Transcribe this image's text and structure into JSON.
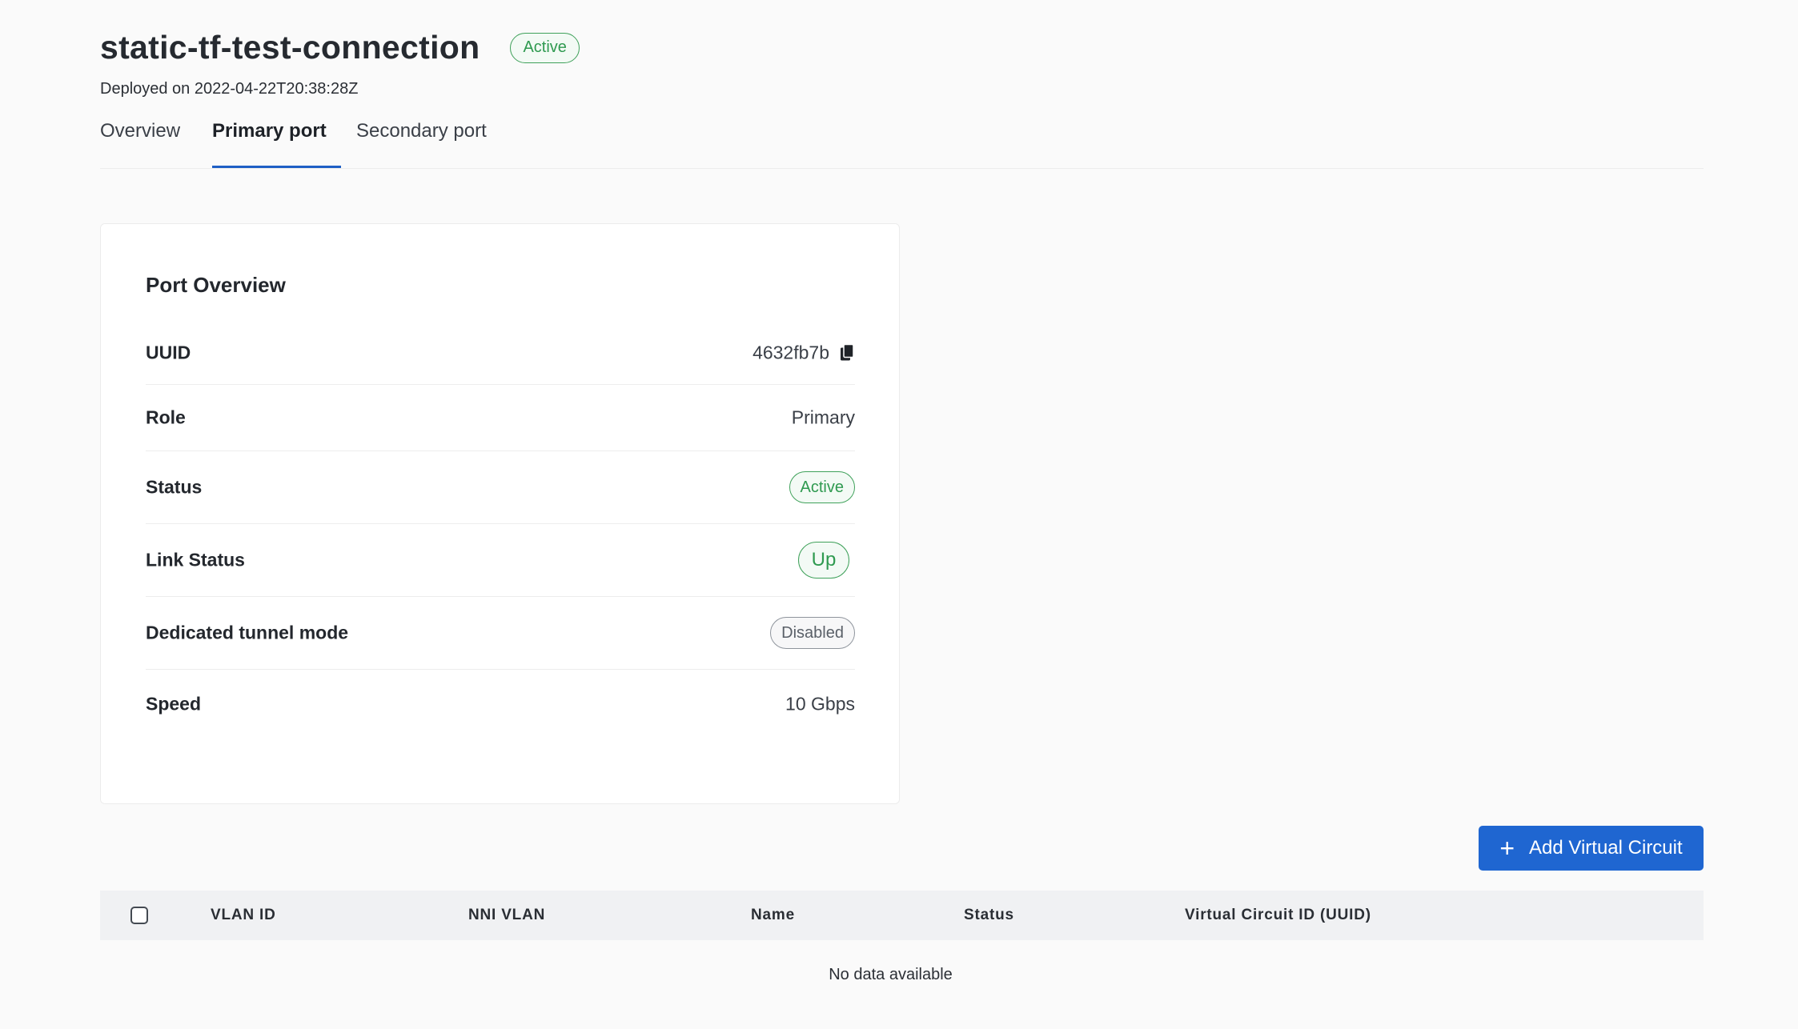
{
  "header": {
    "title": "static-tf-test-connection",
    "status": "Active",
    "subtitle": "Deployed on 2022-04-22T20:38:28Z"
  },
  "tabs": [
    {
      "label": "Overview",
      "active": false
    },
    {
      "label": "Primary port",
      "active": true
    },
    {
      "label": "Secondary port",
      "active": false
    }
  ],
  "port_overview": {
    "title": "Port Overview",
    "uuid_label": "UUID",
    "uuid_value": "4632fb7b",
    "role_label": "Role",
    "role_value": "Primary",
    "status_label": "Status",
    "status_value": "Active",
    "link_status_label": "Link Status",
    "link_status_value": "Up",
    "tunnel_label": "Dedicated tunnel mode",
    "tunnel_value": "Disabled",
    "speed_label": "Speed",
    "speed_value": "10 Gbps"
  },
  "actions": {
    "add_vc_label": "Add Virtual Circuit",
    "add_vc_icon": "plus-icon"
  },
  "table": {
    "columns": [
      "VLAN ID",
      "NNI VLAN",
      "Name",
      "Status",
      "Virtual Circuit ID (UUID)"
    ],
    "empty_text": "No data available"
  },
  "colors": {
    "accent": "#1f66d1",
    "success": "#2f9a50",
    "muted": "#5a6068"
  }
}
